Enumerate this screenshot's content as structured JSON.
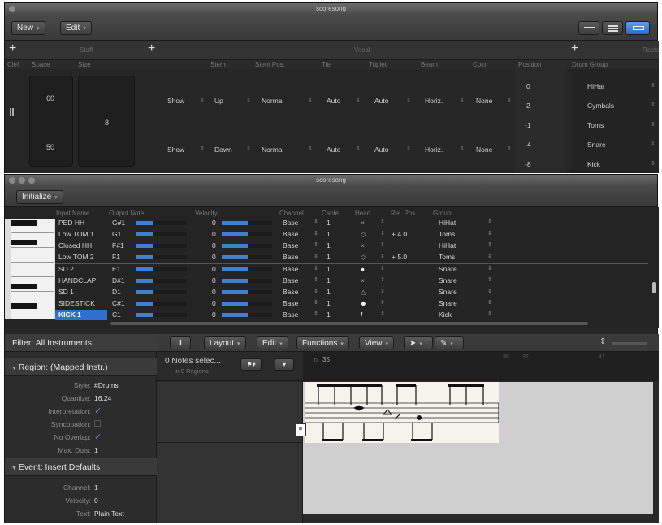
{
  "top_window": {
    "title": "scoresong",
    "new_label": "New",
    "edit_label": "Edit",
    "plus_symbol": "+",
    "group_labels": {
      "staff": "Staff",
      "vocal": "Vocal",
      "right": "Rests"
    },
    "col_headers": {
      "clef": "Clef",
      "space": "Space",
      "size": "Size",
      "stem": "Stem",
      "stem_pos": "Stem Pos.",
      "tie": "Tie",
      "tuplet": "Tuplet",
      "beam": "Beam",
      "color": "Color",
      "position": "Position",
      "drum_group": "Drum Group"
    },
    "space_values": [
      "60",
      "50"
    ],
    "size_value": "8",
    "row1": {
      "rest": "Show",
      "stem": "Up",
      "stem_pos": "Normal",
      "tie": "Auto",
      "tuplet": "Auto",
      "beam": "Horiz.",
      "color": "None"
    },
    "row2": {
      "rest": "Show",
      "stem": "Down",
      "stem_pos": "Normal",
      "tie": "Auto",
      "tuplet": "Auto",
      "beam": "Horiz.",
      "color": "None"
    },
    "positions": [
      "0",
      "2",
      "-1",
      "-4",
      "-8"
    ],
    "drum_groups": [
      "HiHat",
      "Cymbals",
      "Toms",
      "Snare",
      "Kick"
    ]
  },
  "bottom_window": {
    "title": "scoresong",
    "initialize_label": "Initialize",
    "mapped_headers": {
      "input_name": "Input Name",
      "output_note": "Output Note",
      "velocity": "Velocity",
      "channel": "Channel",
      "cable": "Cable",
      "head": "Head",
      "rel_pos": "Rel. Pos.",
      "group": "Group"
    },
    "rows": [
      {
        "name": "PED HH",
        "note": "G#1",
        "vel": "0",
        "ch": "Base",
        "cable": "1",
        "head": "×",
        "rel": "",
        "group": "HiHat"
      },
      {
        "name": "Low TOM 1",
        "note": "G1",
        "vel": "0",
        "ch": "Base",
        "cable": "1",
        "head": "◇",
        "rel": "+ 4.0",
        "group": "Toms"
      },
      {
        "name": "Closed HH",
        "note": "F#1",
        "vel": "0",
        "ch": "Base",
        "cable": "1",
        "head": "×",
        "rel": "",
        "group": "HiHat"
      },
      {
        "name": "Low TOM 2",
        "note": "F1",
        "vel": "0",
        "ch": "Base",
        "cable": "1",
        "head": "◇",
        "rel": "+ 5.0",
        "group": "Toms"
      },
      {
        "name": "SD 2",
        "note": "E1",
        "vel": "0",
        "ch": "Base",
        "cable": "1",
        "head": "●",
        "rel": "",
        "group": "Snare"
      },
      {
        "name": "HANDCLAP",
        "note": "D#1",
        "vel": "0",
        "ch": "Base",
        "cable": "1",
        "head": "×",
        "rel": "",
        "group": "Snare"
      },
      {
        "name": "SD 1",
        "note": "D1",
        "vel": "0",
        "ch": "Base",
        "cable": "1",
        "head": "△",
        "rel": "",
        "group": "Snare"
      },
      {
        "name": "SIDESTICK",
        "note": "C#1",
        "vel": "0",
        "ch": "Base",
        "cable": "1",
        "head": "◆",
        "rel": "",
        "group": "Snare"
      },
      {
        "name": "KICK 1",
        "note": "C1",
        "vel": "0",
        "ch": "Base",
        "cable": "1",
        "head": "/",
        "rel": "",
        "group": "Kick"
      }
    ],
    "filter_label": "Filter: All Instruments",
    "region_header": "Region: (Mapped Instr.)",
    "region_fields": [
      {
        "label": "Style:",
        "value": "#Drums"
      },
      {
        "label": "Quantize:",
        "value": "16,24"
      },
      {
        "label": "Interpretation:",
        "value": "✓"
      },
      {
        "label": "Syncopation:",
        "value": ""
      },
      {
        "label": "No Overlap:",
        "value": "✓"
      },
      {
        "label": "Max. Dots:",
        "value": "1"
      }
    ],
    "event_header": "Event: Insert Defaults",
    "event_fields": [
      {
        "label": "Channel:",
        "value": "1"
      },
      {
        "label": "Velocity:",
        "value": "0"
      },
      {
        "label": "Text:",
        "value": "Plain Text"
      }
    ],
    "menus": {
      "layout": "Layout",
      "edit": "Edit",
      "functions": "Functions",
      "view": "View"
    },
    "notes_selected": "0 Notes selec...",
    "in_regions": "in 0 Regions",
    "bar_numbers": [
      "35",
      "36",
      "37",
      "41"
    ]
  }
}
